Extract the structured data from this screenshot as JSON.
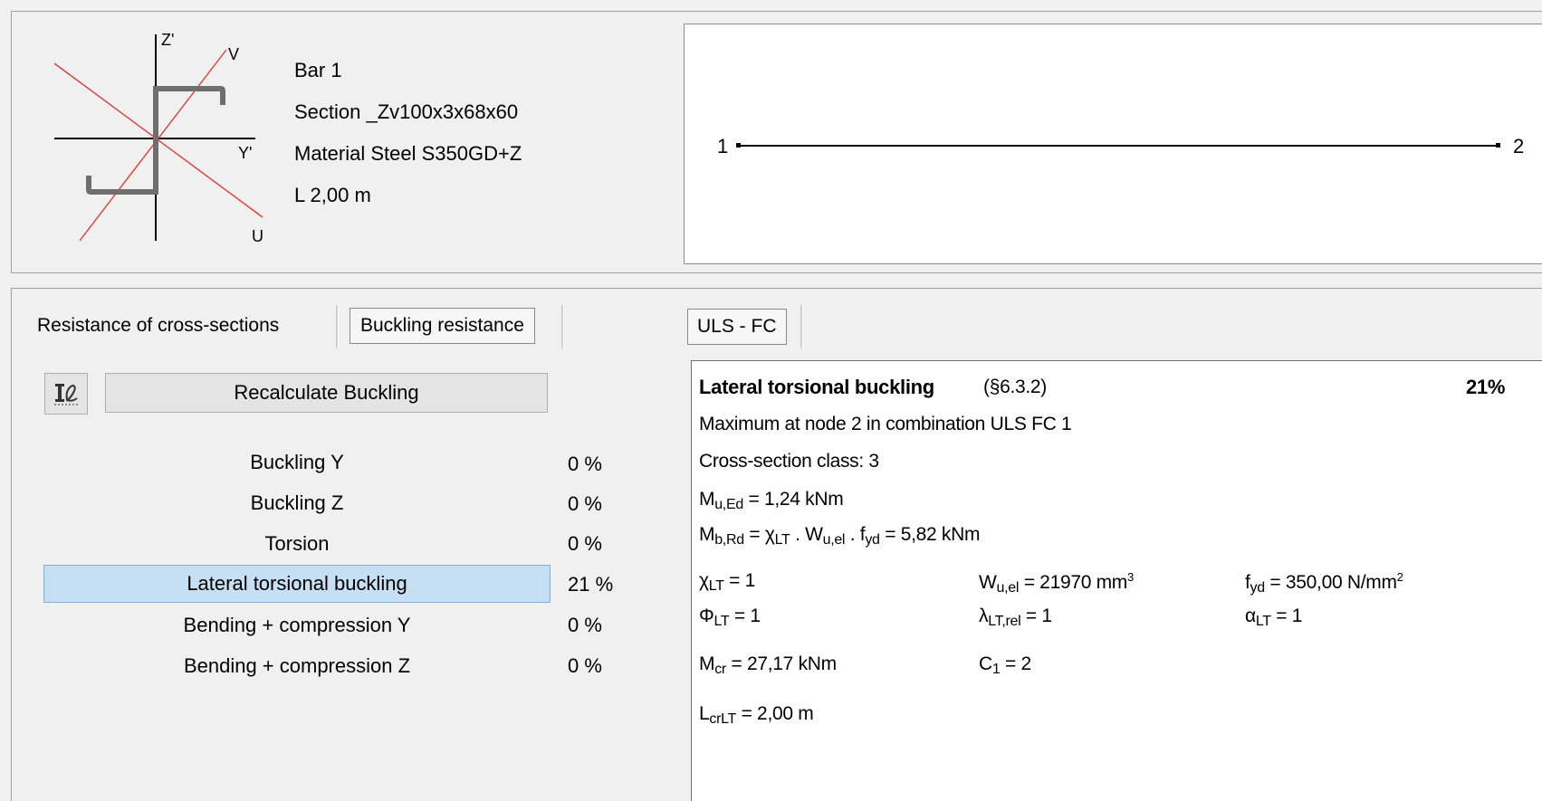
{
  "bar": {
    "name": "Bar 1",
    "section": "Section _Zv100x3x68x60",
    "material": "Material Steel S350GD+Z",
    "length": "L 2,00 m"
  },
  "axes": {
    "z": "Z'",
    "y": "Y'",
    "v": "V",
    "u": "U"
  },
  "diagram": {
    "node_start": "1",
    "node_end": "2"
  },
  "tabs": {
    "cross_sections": "Resistance of cross-sections",
    "buckling": "Buckling resistance",
    "uls": "ULS - FC"
  },
  "recalc_label": "Recalculate Buckling",
  "checks": [
    {
      "label": "Buckling Y",
      "value": "0 %"
    },
    {
      "label": "Buckling Z",
      "value": "0 %"
    },
    {
      "label": "Torsion",
      "value": "0 %"
    },
    {
      "label": "Lateral torsional buckling",
      "value": "21 %",
      "selected": true
    },
    {
      "label": "Bending + compression Y",
      "value": "0 %"
    },
    {
      "label": "Bending + compression Z",
      "value": "0 %"
    }
  ],
  "detail": {
    "title": "Lateral torsional buckling",
    "clause": "(§6.3.2)",
    "percent": "21%",
    "max_line": "Maximum at node 2 in combination ULS FC 1",
    "class_line": "Cross-section class: 3",
    "mu_ed": "= 1,24 kNm",
    "mb_rd": "= 5,82 kNm",
    "chi_lt": "= 1",
    "wu_el": "= 21970 mm",
    "fyd": "= 350,00 N/mm",
    "phi_lt": "= 1",
    "lambda_lt": "= 1",
    "alpha_lt": "= 1",
    "mcr": "= 27,17 kNm",
    "c1": "= 2",
    "lcr": "= 2,00 m"
  },
  "colors": {
    "selection": "#c7dff3",
    "axis_red": "#e23b3b",
    "section_gray": "#6e6e6e"
  }
}
